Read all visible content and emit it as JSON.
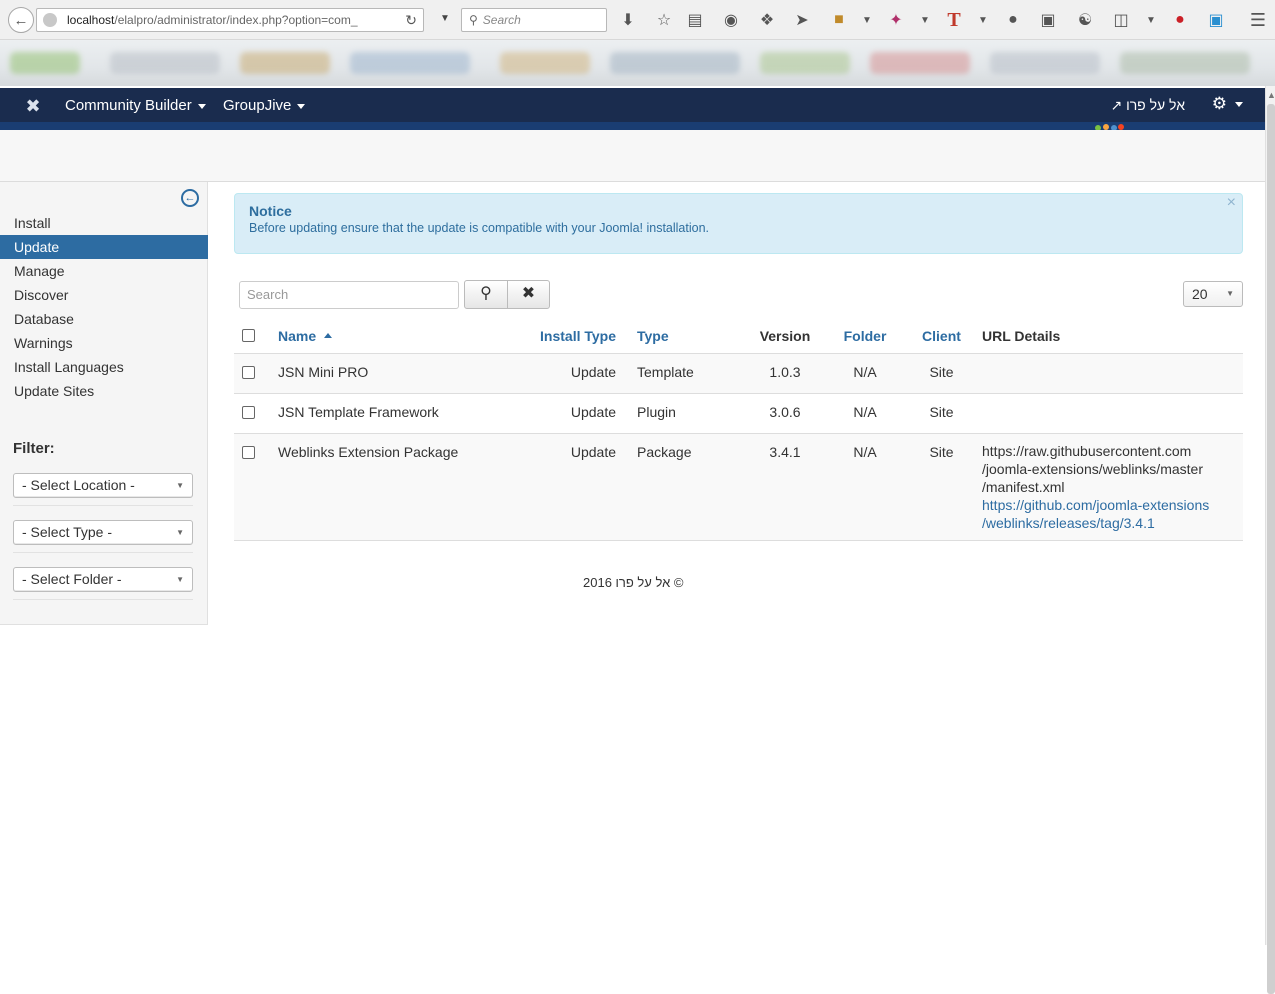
{
  "browser": {
    "url_host": "localhost",
    "url_path": "/elalpro/administrator/index.php?option=com_",
    "search_placeholder": "Search"
  },
  "topnav": {
    "menus": [
      "Community Builder",
      "GroupJive"
    ],
    "site_name": "אל על פרו"
  },
  "sidebar": {
    "items": [
      {
        "label": "Install",
        "active": false
      },
      {
        "label": "Update",
        "active": true
      },
      {
        "label": "Manage",
        "active": false
      },
      {
        "label": "Discover",
        "active": false
      },
      {
        "label": "Database",
        "active": false
      },
      {
        "label": "Warnings",
        "active": false
      },
      {
        "label": "Install Languages",
        "active": false
      },
      {
        "label": "Update Sites",
        "active": false
      }
    ],
    "filter_title": "Filter:",
    "filters": [
      "- Select Location -",
      "- Select Type -",
      "- Select Folder -"
    ]
  },
  "notice": {
    "title": "Notice",
    "message": "Before updating ensure that the update is compatible with your Joomla! installation."
  },
  "toolbar": {
    "search_placeholder": "Search",
    "limit": "20"
  },
  "table": {
    "headers": {
      "name": "Name",
      "install_type": "Install Type",
      "type": "Type",
      "version": "Version",
      "folder": "Folder",
      "client": "Client",
      "url_details": "URL Details"
    },
    "rows": [
      {
        "name": "JSN Mini PRO",
        "install_type": "Update",
        "type": "Template",
        "version": "1.0.3",
        "folder": "N/A",
        "client": "Site",
        "url_lines": [],
        "link_lines": []
      },
      {
        "name": "JSN Template Framework",
        "install_type": "Update",
        "type": "Plugin",
        "version": "3.0.6",
        "folder": "N/A",
        "client": "Site",
        "url_lines": [],
        "link_lines": []
      },
      {
        "name": "Weblinks Extension Package",
        "install_type": "Update",
        "type": "Package",
        "version": "3.4.1",
        "folder": "N/A",
        "client": "Site",
        "url_lines": [
          "https://raw.githubusercontent.com",
          "/joomla-extensions/weblinks/master",
          "/manifest.xml"
        ],
        "link_lines": [
          "https://github.com/joomla-extensions",
          "/weblinks/releases/tag/3.4.1"
        ]
      }
    ]
  },
  "footer": {
    "text": "אל על פרו 2016 ©"
  }
}
